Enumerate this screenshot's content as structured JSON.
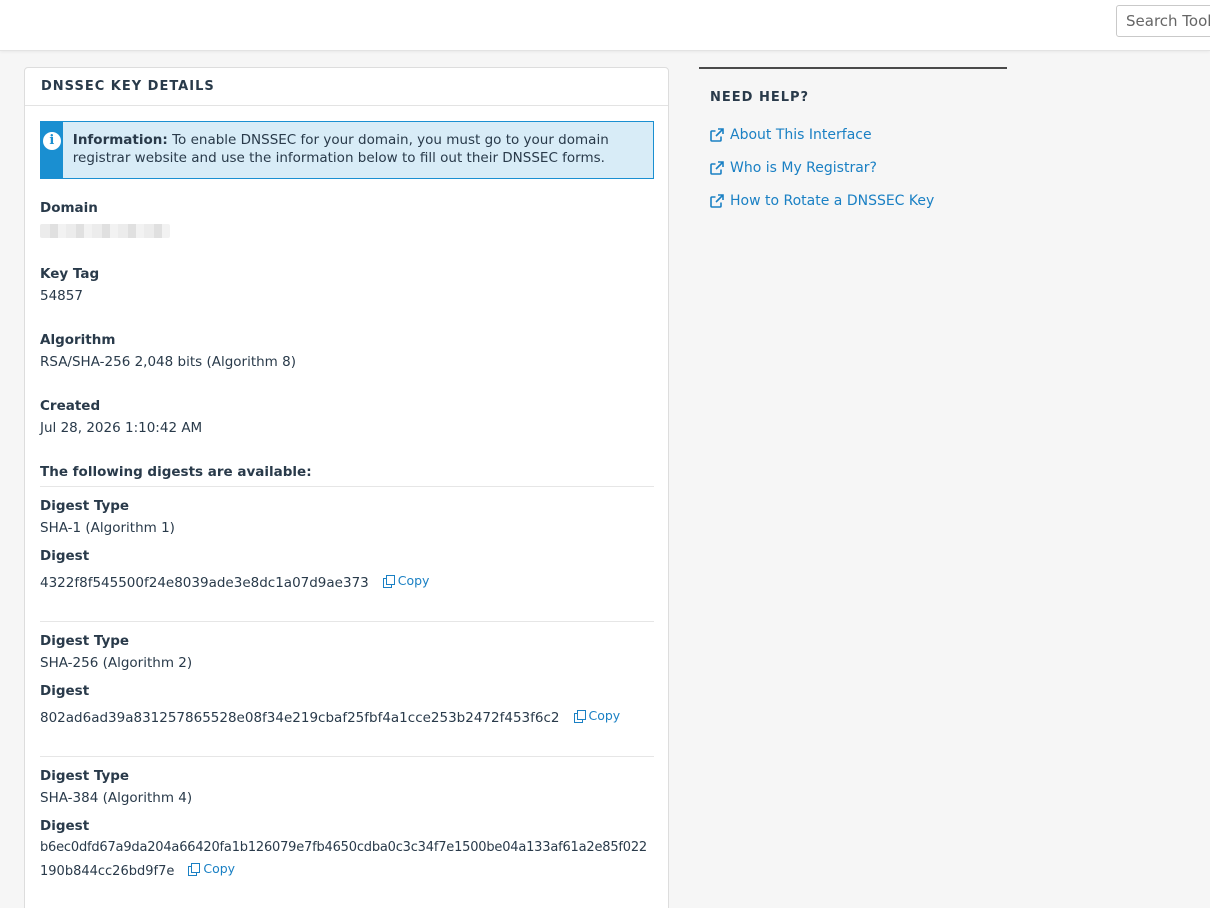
{
  "topbar": {
    "search_placeholder": "Search Tools"
  },
  "panel": {
    "title": "DNSSEC KEY DETAILS",
    "info": {
      "prefix": "Information:",
      "message": "To enable DNSSEC for your domain, you must go to your domain registrar website and use the information below to fill out their DNSSEC forms."
    },
    "domain": {
      "label": "Domain"
    },
    "key_tag": {
      "label": "Key Tag",
      "value": "54857"
    },
    "algorithm": {
      "label": "Algorithm",
      "value": "RSA/SHA-256 2,048 bits (Algorithm 8)"
    },
    "created": {
      "label": "Created",
      "value": "Jul 28, 2026 1:10:42 AM"
    },
    "digests_heading": "The following digests are available:",
    "digests": [
      {
        "type_label": "Digest Type",
        "type_value": "SHA-1 (Algorithm 1)",
        "digest_label": "Digest",
        "digest_value": "4322f8f545500f24e8039ade3e8dc1a07d9ae373",
        "copy_label": "Copy"
      },
      {
        "type_label": "Digest Type",
        "type_value": "SHA-256 (Algorithm 2)",
        "digest_label": "Digest",
        "digest_value": "802ad6ad39a831257865528e08f34e219cbaf25fbf4a1cce253b2472f453f6c2",
        "copy_label": "Copy"
      },
      {
        "type_label": "Digest Type",
        "type_value": "SHA-384 (Algorithm 4)",
        "digest_label": "Digest",
        "digest_value_line1": "b6ec0dfd67a9da204a66420fa1b126079e7fb4650cdba0c3c34f7e1500be04a133af61a2e85f022",
        "digest_value_line2": "190b844cc26bd9f7e",
        "copy_label": "Copy"
      }
    ]
  },
  "help": {
    "title": "NEED HELP?",
    "links": [
      "About This Interface",
      "Who is My Registrar?",
      "How to Rotate a DNSSEC Key"
    ]
  },
  "colors": {
    "accent": "#1a80c4",
    "info_bg": "#d8ecf7",
    "info_border": "#1a8fd1"
  }
}
